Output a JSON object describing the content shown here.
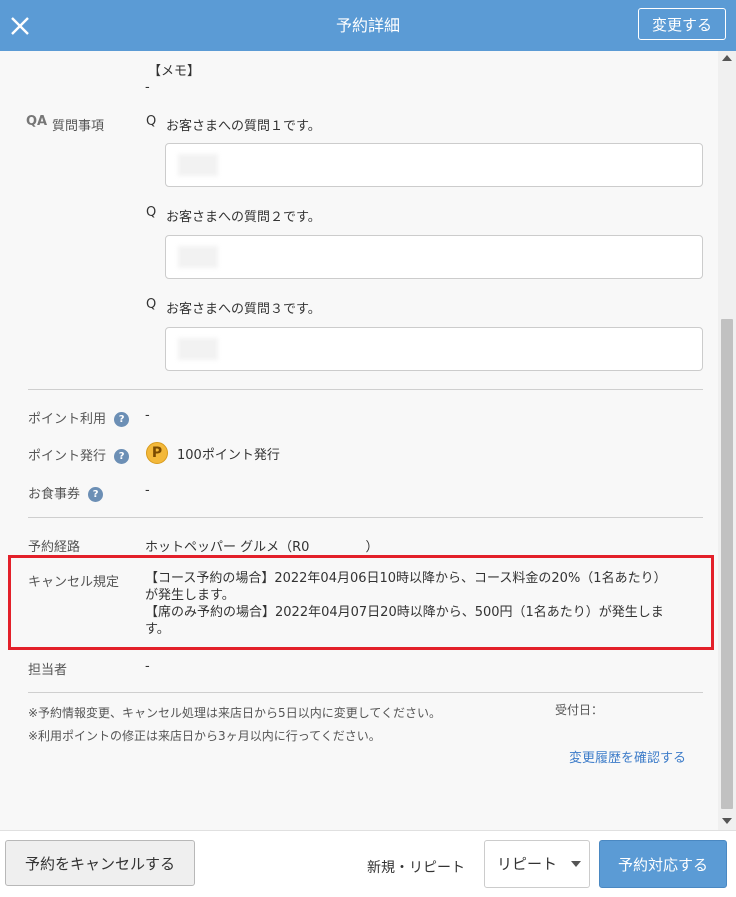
{
  "header": {
    "title": "予約詳細",
    "change_label": "変更する"
  },
  "memo": {
    "label": "【メモ】",
    "value": "-"
  },
  "questions": {
    "section_label": "質問事項",
    "qa_icon": "QA",
    "items": [
      {
        "prefix": "Q",
        "text": "お客さまへの質問１です。"
      },
      {
        "prefix": "Q",
        "text": "お客さまへの質問２です。"
      },
      {
        "prefix": "Q",
        "text": "お客さまへの質問３です。"
      }
    ]
  },
  "points": {
    "use_label": "ポイント利用",
    "use_value": "-",
    "issue_label": "ポイント発行",
    "issue_icon": "P",
    "issue_value": "100ポイント発行",
    "meal_ticket_label": "お食事券",
    "meal_ticket_value": "-",
    "help_glyph": "?"
  },
  "route": {
    "label": "予約経路",
    "value_start": "ホットペッパー グルメ（R0",
    "value_end": "）"
  },
  "cancel_policy": {
    "label": "キャンセル規定",
    "line1": "【コース予約の場合】2022年04月06日10時以降から、コース料金の20%（1名あたり）",
    "line2": "が発生します。",
    "line3": "【席のみ予約の場合】2022年04月07日20時以降から、500円（1名あたり）が発生しま",
    "line4": "す。"
  },
  "staff": {
    "label": "担当者",
    "value": "-"
  },
  "notes": {
    "note1": "※予約情報変更、キャンセル処理は来店日から5日以内に変更してください。",
    "note2": "※利用ポイントの修正は来店日から3ヶ月以内に行ってください。",
    "received_label": "受付日：",
    "history_link": "変更履歴を確認する"
  },
  "footer": {
    "cancel_label": "予約をキャンセルする",
    "visit_type_label": "新規・リピート",
    "visit_type_selected": "リピート",
    "respond_label": "予約対応する"
  },
  "colors": {
    "header_bg": "#5b9bd5",
    "highlight_border": "#e3202a",
    "link": "#3d7cc9"
  }
}
